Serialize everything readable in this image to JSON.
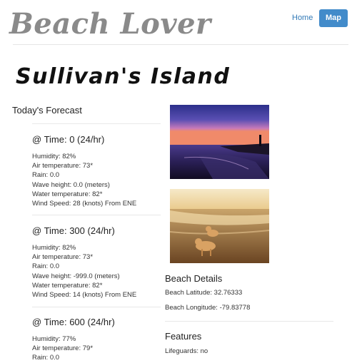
{
  "header": {
    "logo": "Beach Lover",
    "home": "Home",
    "map": "Map"
  },
  "beach": {
    "name": "Sullivan's Island"
  },
  "forecast": {
    "heading": "Today's Forecast",
    "blocks": [
      {
        "time": "@ Time: 0 (24/hr)",
        "humidity": "Humidity: 82%",
        "air": "Air temperature: 73*",
        "rain": "Rain: 0.0",
        "wave": "Wave height: 0.0 (meters)",
        "water": "Water temperature: 82*",
        "wind": "Wind Speed: 28 (knots) From ENE"
      },
      {
        "time": "@ Time: 300 (24/hr)",
        "humidity": "Humidity: 82%",
        "air": "Air temperature: 73*",
        "rain": "Rain: 0.0",
        "wave": "Wave height: -999.0 (meters)",
        "water": "Water temperature: 82*",
        "wind": "Wind Speed: 14 (knots) From ENE"
      },
      {
        "time": "@ Time: 600 (24/hr)",
        "humidity": "Humidity: 77%",
        "air": "Air temperature: 79*",
        "rain": "Rain: 0.0"
      }
    ]
  },
  "details": {
    "heading": "Beach Details",
    "latitude": "Beach Latitude: 32.76333",
    "longitude": "Beach Longitude: -79.83778"
  },
  "features": {
    "heading": "Features",
    "lifeguards": "Lifeguards: no"
  }
}
